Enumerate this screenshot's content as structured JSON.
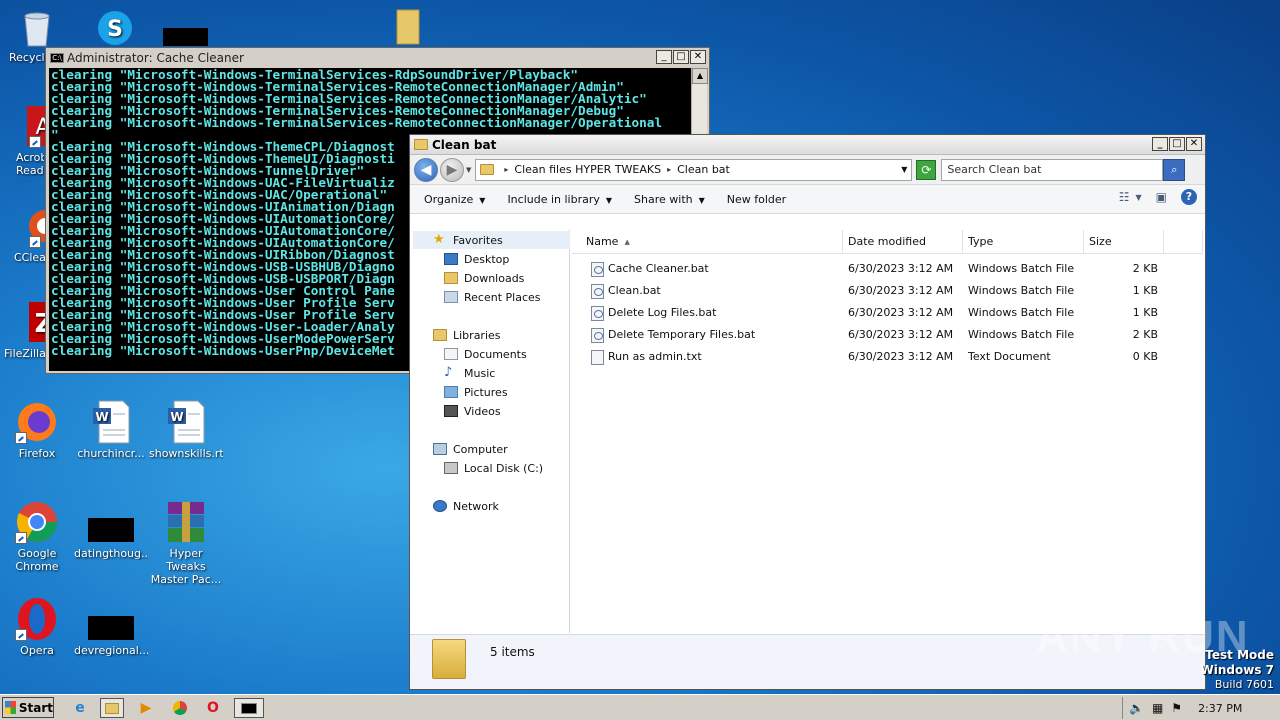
{
  "desktop": {
    "icons": [
      {
        "id": "recycle",
        "label": "Recycle"
      },
      {
        "id": "acrobat",
        "label": "Acrob Reader"
      },
      {
        "id": "ccleaner",
        "label": "CClea"
      },
      {
        "id": "filezilla",
        "label": "FileZilla"
      },
      {
        "id": "firefox",
        "label": "Firefox"
      },
      {
        "id": "churchincr",
        "label": "churchincr..."
      },
      {
        "id": "shownskills",
        "label": "shownskills.rtf"
      },
      {
        "id": "chrome",
        "label": "Google Chrome"
      },
      {
        "id": "datingthough",
        "label": "datingthoug..."
      },
      {
        "id": "hypertweaks",
        "label": "Hyper Tweaks Master Pac..."
      },
      {
        "id": "opera",
        "label": "Opera"
      },
      {
        "id": "devregional",
        "label": "devregional..."
      }
    ]
  },
  "cmd": {
    "title": "Administrator:  Cache Cleaner",
    "icon_text": "C:\\",
    "lines": [
      "clearing \"Microsoft-Windows-TerminalServices-RdpSoundDriver/Playback\"",
      "clearing \"Microsoft-Windows-TerminalServices-RemoteConnectionManager/Admin\"",
      "clearing \"Microsoft-Windows-TerminalServices-RemoteConnectionManager/Analytic\"",
      "clearing \"Microsoft-Windows-TerminalServices-RemoteConnectionManager/Debug\"",
      "clearing \"Microsoft-Windows-TerminalServices-RemoteConnectionManager/Operational",
      "\"",
      "clearing \"Microsoft-Windows-ThemeCPL/Diagnost",
      "clearing \"Microsoft-Windows-ThemeUI/Diagnosti",
      "clearing \"Microsoft-Windows-TunnelDriver\"",
      "clearing \"Microsoft-Windows-UAC-FileVirtualiz",
      "clearing \"Microsoft-Windows-UAC/Operational\"",
      "clearing \"Microsoft-Windows-UIAnimation/Diagn",
      "clearing \"Microsoft-Windows-UIAutomationCore/",
      "clearing \"Microsoft-Windows-UIAutomationCore/",
      "clearing \"Microsoft-Windows-UIAutomationCore/",
      "clearing \"Microsoft-Windows-UIRibbon/Diagnost",
      "clearing \"Microsoft-Windows-USB-USBHUB/Diagno",
      "clearing \"Microsoft-Windows-USB-USBPORT/Diagn",
      "clearing \"Microsoft-Windows-User Control Pane",
      "clearing \"Microsoft-Windows-User Profile Serv",
      "clearing \"Microsoft-Windows-User Profile Serv",
      "clearing \"Microsoft-Windows-User-Loader/Analy",
      "clearing \"Microsoft-Windows-UserModePowerServ",
      "clearing \"Microsoft-Windows-UserPnp/DeviceMet"
    ]
  },
  "explorer": {
    "title": "Clean bat",
    "breadcrumb": [
      "Clean files HYPER TWEAKS",
      "Clean bat"
    ],
    "search_placeholder": "Search Clean bat",
    "toolbar": {
      "organize": "Organize",
      "include_in_library": "Include in library",
      "share_with": "Share with",
      "new_folder": "New folder"
    },
    "nav": {
      "favorites": "Favorites",
      "desktop": "Desktop",
      "downloads": "Downloads",
      "recent_places": "Recent Places",
      "libraries": "Libraries",
      "documents": "Documents",
      "music": "Music",
      "pictures": "Pictures",
      "videos": "Videos",
      "computer": "Computer",
      "local_disk": "Local Disk (C:)",
      "network": "Network"
    },
    "columns": {
      "name": "Name",
      "date_modified": "Date modified",
      "type": "Type",
      "size": "Size"
    },
    "files": [
      {
        "name": "Cache Cleaner.bat",
        "date": "6/30/2023 3:12 AM",
        "type": "Windows Batch File",
        "size": "2 KB",
        "kind": "bat"
      },
      {
        "name": "Clean.bat",
        "date": "6/30/2023 3:12 AM",
        "type": "Windows Batch File",
        "size": "1 KB",
        "kind": "bat"
      },
      {
        "name": "Delete Log Files.bat",
        "date": "6/30/2023 3:12 AM",
        "type": "Windows Batch File",
        "size": "1 KB",
        "kind": "bat"
      },
      {
        "name": "Delete Temporary Files.bat",
        "date": "6/30/2023 3:12 AM",
        "type": "Windows Batch File",
        "size": "2 KB",
        "kind": "bat"
      },
      {
        "name": "Run as admin.txt",
        "date": "6/30/2023 3:12 AM",
        "type": "Text Document",
        "size": "0 KB",
        "kind": "txt"
      }
    ],
    "status": "5 items"
  },
  "watermark": "ANY RUN",
  "testmode": {
    "line1": "Test Mode",
    "line2": "Windows 7",
    "line3": "Build 7601"
  },
  "taskbar": {
    "start": "Start",
    "clock": "2:37 PM"
  }
}
